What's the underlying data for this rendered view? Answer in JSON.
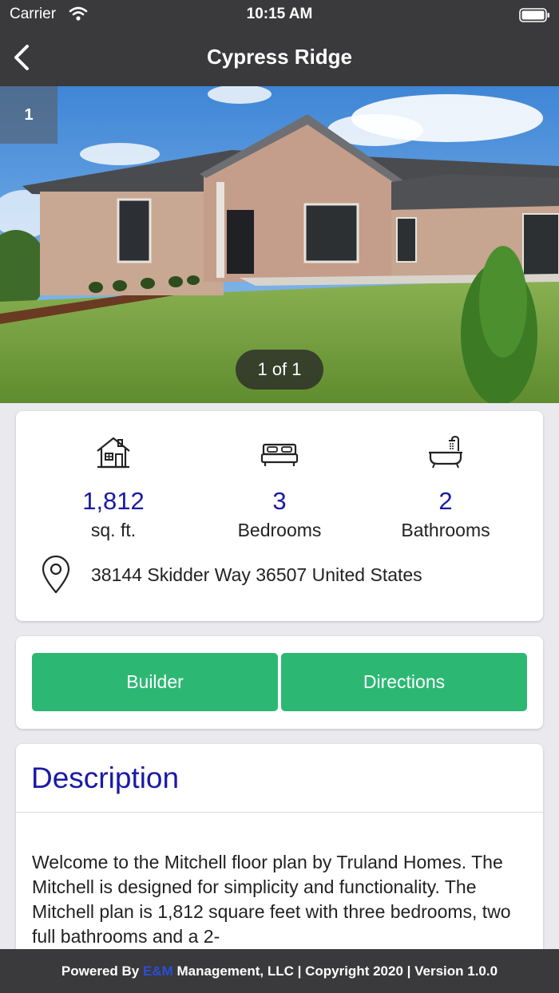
{
  "status_bar": {
    "carrier": "Carrier",
    "time": "10:15 AM"
  },
  "nav": {
    "title": "Cypress Ridge"
  },
  "gallery": {
    "index_badge": "1",
    "counter": "1 of 1"
  },
  "stats": {
    "sqft_value": "1,812",
    "sqft_label": "sq. ft.",
    "bedrooms_value": "3",
    "bedrooms_label": "Bedrooms",
    "bathrooms_value": "2",
    "bathrooms_label": "Bathrooms",
    "address": "38144 Skidder Way   36507 United States"
  },
  "actions": {
    "builder_label": "Builder",
    "directions_label": "Directions"
  },
  "description": {
    "title": "Description",
    "text": "Welcome to the Mitchell floor plan by Truland Homes. The Mitchell is designed for simplicity and functionality. The Mitchell plan is 1,812 square feet with three bedrooms, two full bathrooms and a 2-"
  },
  "footer": {
    "prefix": "Powered By ",
    "brand_e": "E&",
    "brand_m": "M",
    "suffix": " Management, LLC | Copyright 2020 | Version 1.0.0"
  },
  "colors": {
    "bar_background": "#3a393b",
    "accent_blue": "#1a1aa6",
    "button_green": "#2cb873"
  },
  "icons": [
    "wifi-icon",
    "battery-icon",
    "back-chevron-icon",
    "house-icon",
    "bed-icon",
    "bathtub-icon",
    "location-pin-icon"
  ]
}
